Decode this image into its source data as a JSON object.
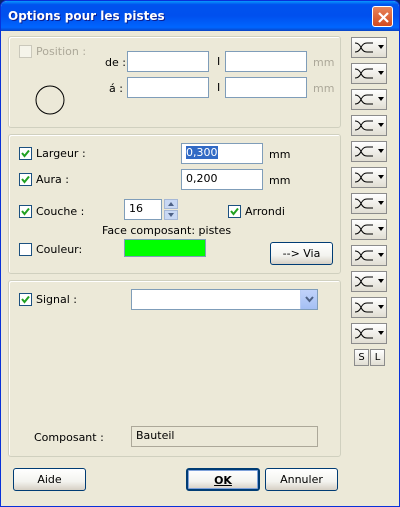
{
  "window": {
    "title": "Options pour les pistes"
  },
  "position": {
    "label": "Position :",
    "de_label": "de :",
    "a_label": "á :",
    "separator": "I",
    "unit": "mm",
    "de_x": "",
    "de_y": "",
    "a_x": "",
    "a_y": ""
  },
  "props": {
    "largeur_label": "Largeur :",
    "largeur_value": "0,300",
    "largeur_unit": "mm",
    "aura_label": "Aura :",
    "aura_value": "0,200",
    "aura_unit": "mm",
    "couche_label": "Couche :",
    "couche_value": "16",
    "arrondi_label": "Arrondi",
    "face_label": "Face composant: pistes",
    "couleur_label": "Couleur:",
    "couleur_color": "#00ff00",
    "via_button": "--> Via"
  },
  "signal": {
    "label": "Signal :",
    "value": "",
    "composant_label": "Composant :",
    "composant_value": "Bauteil"
  },
  "footer": {
    "help": "Aide",
    "ok": "OK",
    "cancel": "Annuler"
  },
  "side": {
    "s_label": "S",
    "l_label": "L",
    "tool_icon": "trace-pattern-icon",
    "tool_count": 12
  }
}
